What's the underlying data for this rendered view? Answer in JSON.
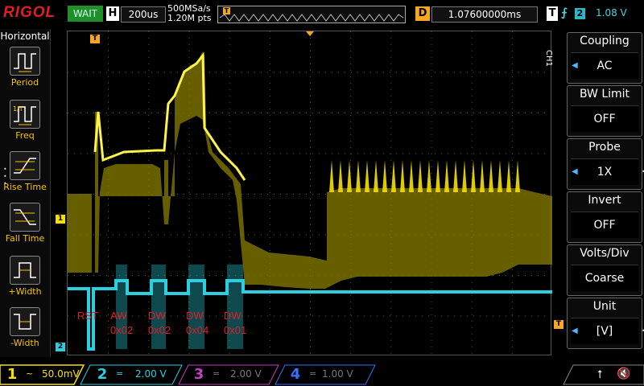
{
  "top": {
    "logo": "RIGOL",
    "run_state": "WAIT",
    "horizontal_label": "H",
    "timebase": "200us",
    "sample_rate": "500MSa/s",
    "memory_depth": "1.20M pts",
    "delay_label": "D",
    "delay": "1.07600000ms",
    "trigger_label": "T",
    "trigger_source": "2",
    "trigger_level": "1.08 V"
  },
  "left_menu": {
    "title": "Horizontal",
    "items": [
      {
        "label": "Period",
        "icon": "period-icon"
      },
      {
        "label": "Freq",
        "icon": "frequency-icon"
      },
      {
        "label": "Rise Time",
        "icon": "rise-time-icon"
      },
      {
        "label": "Fall Time",
        "icon": "fall-time-icon"
      },
      {
        "label": "+Width",
        "icon": "positive-width-icon"
      },
      {
        "label": "-Width",
        "icon": "negative-width-icon"
      }
    ]
  },
  "right_menu": {
    "channel_tag": "CH1",
    "items": [
      {
        "title": "Coupling",
        "value": "AC"
      },
      {
        "title": "BW Limit",
        "value": "OFF"
      },
      {
        "title": "Probe",
        "value": "1X"
      },
      {
        "title": "Invert",
        "value": "OFF"
      },
      {
        "title": "Volts/Div",
        "value": "Coarse"
      },
      {
        "title": "Unit",
        "value": "[V]"
      }
    ]
  },
  "annotations": [
    {
      "top": "RST",
      "bottom": ""
    },
    {
      "top": "AW",
      "bottom": "0x02"
    },
    {
      "top": "DW",
      "bottom": "0x02"
    },
    {
      "top": "DW",
      "bottom": "0x04"
    },
    {
      "top": "DW",
      "bottom": "0x01"
    }
  ],
  "channels": [
    {
      "num": "1",
      "coupling": "~",
      "scale": "50.0mV",
      "color": "#f5e000"
    },
    {
      "num": "2",
      "coupling": "=",
      "scale": "2.00 V",
      "color": "#2bd0e0"
    },
    {
      "num": "3",
      "coupling": "=",
      "scale": "2.00 V",
      "color": "#c040c0"
    },
    {
      "num": "4",
      "coupling": "=",
      "scale": "1.00 V",
      "color": "#3a70ff"
    }
  ],
  "markers": {
    "ch1": "1",
    "ch2": "2",
    "trigger": "T"
  },
  "colors": {
    "ch1": "#f5e000",
    "ch2": "#2bd0e0",
    "brand": "#e21e25",
    "menu_accent": "#f5c400"
  }
}
